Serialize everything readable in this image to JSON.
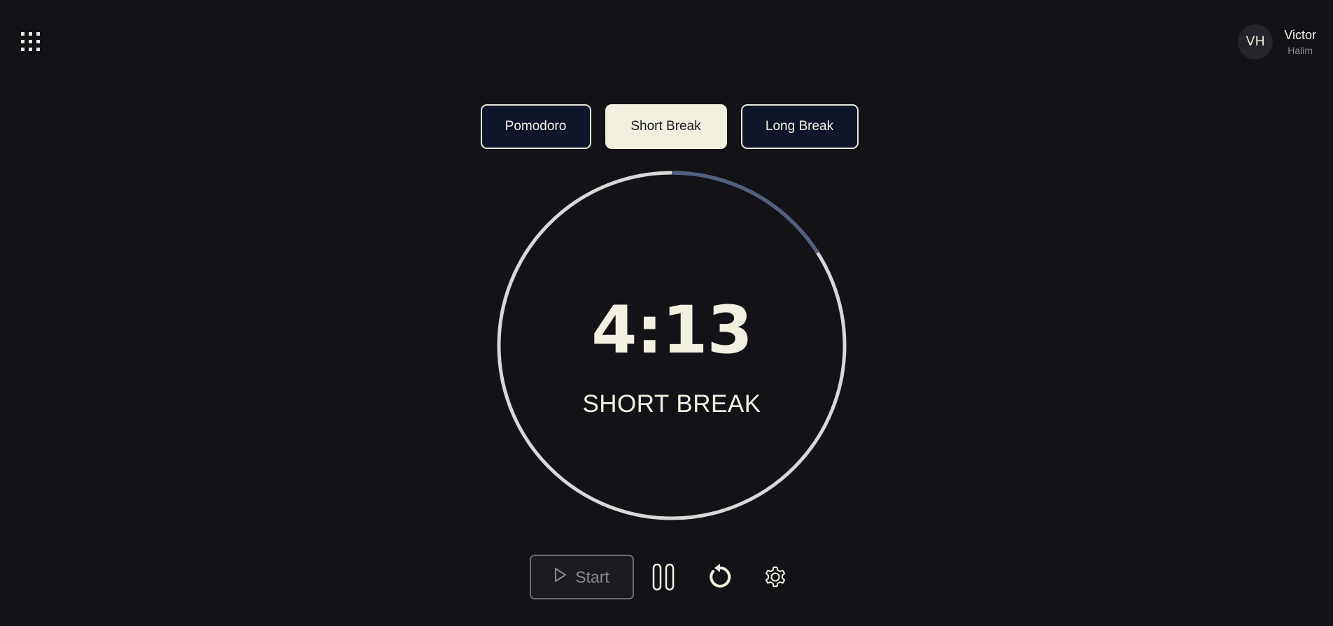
{
  "user": {
    "initials": "VH",
    "first_name": "Victor",
    "last_name": "Halim"
  },
  "icons": {
    "menu": "grid-icon",
    "play": "play-icon",
    "pause": "pause-icon",
    "reset": "reset-icon",
    "settings": "gear-icon"
  },
  "tabs": [
    {
      "label": "Pomodoro",
      "active": false
    },
    {
      "label": "Short Break",
      "active": true
    },
    {
      "label": "Long Break",
      "active": false
    }
  ],
  "timer": {
    "time": "4:13",
    "mode_label": "SHORT BREAK",
    "elapsed_fraction": 0.16,
    "ring_color": "#d8d8d8",
    "progress_color": "#52607f"
  },
  "controls": {
    "start_label": "Start"
  },
  "colors": {
    "background": "#131317",
    "accent_cream": "#f1efe0",
    "tab_dark": "#0f1629"
  }
}
